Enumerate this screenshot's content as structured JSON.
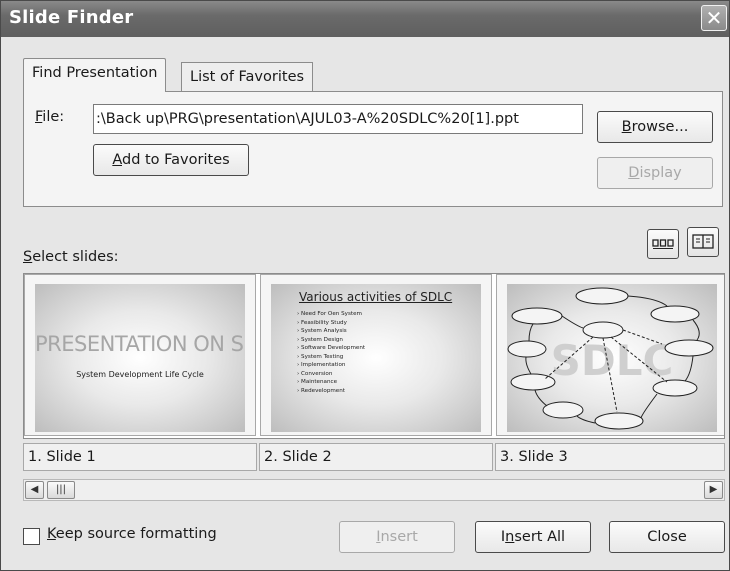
{
  "window": {
    "title": "Slide Finder",
    "close_glyph": "✕"
  },
  "tabs": [
    {
      "label": "Find Presentation",
      "active": true
    },
    {
      "label": "List of Favorites",
      "active": false
    }
  ],
  "file": {
    "label": "File:",
    "value": ":\\Back up\\PRG\\presentation\\AJUL03-A%20SDLC%20[1].ppt"
  },
  "buttons": {
    "browse": "Browse...",
    "add_favorites": "Add to Favorites",
    "display": "Display",
    "insert": "Insert",
    "insert_all": "Insert All",
    "close": "Close"
  },
  "select_slides_label": "Select slides:",
  "slides": [
    {
      "caption": "1. Slide 1",
      "title": "PRESENTATION ON SDLC",
      "subtitle": "System Development Life Cycle"
    },
    {
      "caption": "2. Slide 2",
      "title": "Various activities of SDLC",
      "bullets": [
        "Need For Oen System",
        "Feasibility Study",
        "System Analysis",
        "System Design",
        "Software Development",
        "System Testing",
        "Implementation",
        "Conversion",
        "Maintenance",
        "Redevelopment"
      ]
    },
    {
      "caption": "3. Slide 3",
      "watermark": "SDLC"
    }
  ],
  "keep_formatting": {
    "label": "Keep source formatting",
    "checked": false
  },
  "colors": {
    "titlebar": "#6a6a6a",
    "window_bg": "#e6e6e6",
    "disabled_text": "#a8a8a8"
  },
  "icons": [
    "close-icon",
    "icon-view-icon",
    "list-view-icon",
    "scroll-left-icon",
    "scroll-right-icon"
  ]
}
